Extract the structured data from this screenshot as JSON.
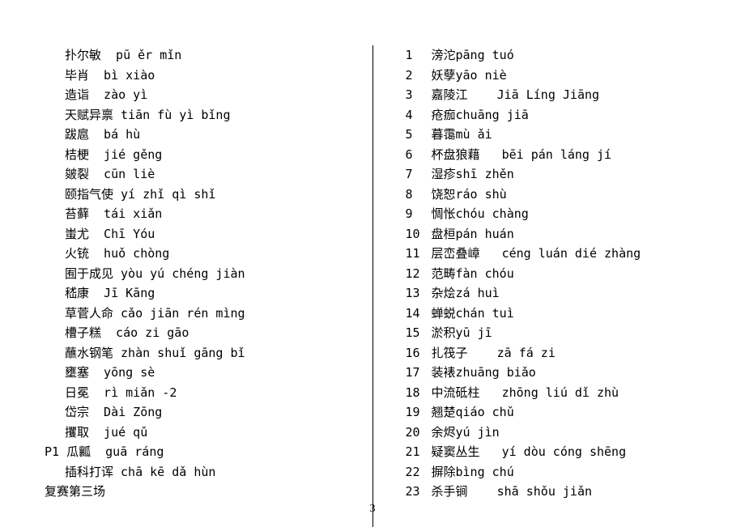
{
  "page_number": "3",
  "left_column": {
    "entries": [
      {
        "text": "扑尔敏  pū ěr mǐn"
      },
      {
        "text": "毕肖  bì xiào"
      },
      {
        "text": "造诣  zào yì"
      },
      {
        "text": "天赋异禀 tiān fù yì bǐng"
      },
      {
        "text": "跋扈  bá hù"
      },
      {
        "text": "桔梗  jié gěng"
      },
      {
        "text": "皴裂  cūn liè"
      },
      {
        "text": "颐指气使 yí zhǐ qì shǐ"
      },
      {
        "text": "苔藓  tái xiǎn"
      },
      {
        "text": "蚩尤  Chī Yóu"
      },
      {
        "text": "火铳  huǒ chòng"
      },
      {
        "text": "囿于成见 yòu yú chéng jiàn"
      },
      {
        "text": "嵇康  Jī Kāng"
      },
      {
        "text": "草菅人命 cǎo jiān rén mìng"
      },
      {
        "text": "槽子糕  cáo zi gāo"
      },
      {
        "text": "蘸水钢笔 zhàn shuǐ gāng bǐ"
      },
      {
        "text": "壅塞  yōng sè"
      },
      {
        "text": "日冕  rì miǎn -2"
      },
      {
        "text": "岱宗  Dài Zōng"
      },
      {
        "text": "攫取  jué qǔ"
      }
    ],
    "p1_entry": "P1 瓜瓤  guā ráng",
    "last_entry": "插科打诨 chā kē dǎ hùn",
    "footer": "复赛第三场"
  },
  "right_column": {
    "entries": [
      {
        "num": "1",
        "text": "滂沱pāng tuó"
      },
      {
        "num": "2",
        "text": "妖孽yāo niè"
      },
      {
        "num": "3",
        "text": "嘉陵江    Jiā Líng Jiāng"
      },
      {
        "num": "4",
        "text": "疮痂chuāng jiā"
      },
      {
        "num": "5",
        "text": "暮霭mù ǎi"
      },
      {
        "num": "6",
        "text": "杯盘狼藉   bēi pán láng jí"
      },
      {
        "num": "7",
        "text": "湿疹shī zhěn"
      },
      {
        "num": "8",
        "text": "饶恕ráo shù"
      },
      {
        "num": "9",
        "text": "惆怅chóu chàng"
      },
      {
        "num": "10",
        "text": "盘桓pán huán"
      },
      {
        "num": "11",
        "text": "层峦叠嶂   céng luán dié zhàng"
      },
      {
        "num": "12",
        "text": "范畴fàn chóu"
      },
      {
        "num": "13",
        "text": "杂烩zá huì"
      },
      {
        "num": "14",
        "text": "蝉蜕chán tuì"
      },
      {
        "num": "15",
        "text": "淤积yū jī"
      },
      {
        "num": "16",
        "text": "扎筏子    zā fá zi"
      },
      {
        "num": "17",
        "text": "装裱zhuāng biǎo"
      },
      {
        "num": "18",
        "text": "中流砥柱   zhōng liú dǐ zhù"
      },
      {
        "num": "19",
        "text": "翘楚qiáo chǔ"
      },
      {
        "num": "20",
        "text": "余烬yú jìn"
      },
      {
        "num": "21",
        "text": "疑窦丛生   yí dòu cóng shēng"
      },
      {
        "num": "22",
        "text": "摒除bìng chú"
      },
      {
        "num": "23",
        "text": "杀手锏    shā shǒu jiǎn"
      }
    ]
  }
}
